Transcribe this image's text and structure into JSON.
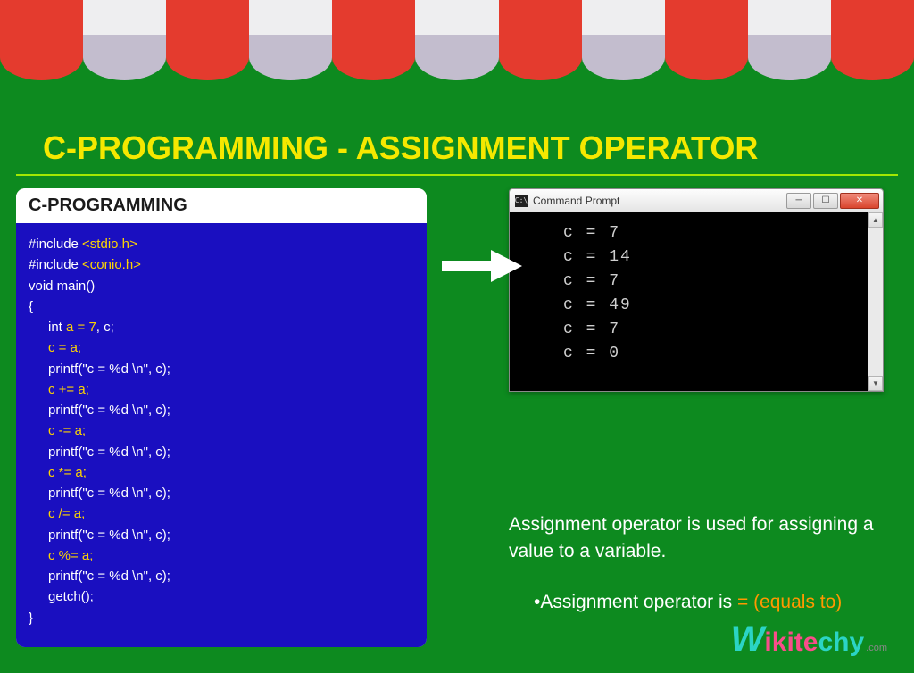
{
  "title": "C-PROGRAMMING - ASSIGNMENT OPERATOR",
  "code_header": "C-PROGRAMMING",
  "code": {
    "inc1a": "#include ",
    "inc1b": "<stdio.h>",
    "inc2a": "#include ",
    "inc2b": "<conio.h>",
    "main": "void main()",
    "ob": "{",
    "decl_a": "int ",
    "decl_b": "a = 7",
    "decl_c": ", c;",
    "s1": "c = a;",
    "p1": "printf(\"c = %d \\n\", c);",
    "s2": "c += a;",
    "p2": "printf(\"c = %d \\n\", c);",
    "s3": "c -= a;",
    "p3": "printf(\"c = %d \\n\", c);",
    "s4": "c *= a;",
    "p4": "printf(\"c = %d \\n\", c);",
    "s5": "c /= a;",
    "p5": "printf(\"c = %d \\n\", c);",
    "s6": "c %= a;",
    "p6": "printf(\"c = %d \\n\", c);",
    "getch": "getch();",
    "cb": "}"
  },
  "cmd": {
    "icon": "C:\\",
    "title": "Command Prompt",
    "output": "c = 7\nc = 14\nc = 7\nc = 49\nc = 7\nc = 0"
  },
  "desc": {
    "line1": "Assignment operator is used for assigning a value to a variable.",
    "bullet_a": "•Assignment operator is ",
    "bullet_b": "= (equals to)"
  },
  "logo": {
    "w": "W",
    "mid": "ikite",
    "end": "chy",
    "com": ".com"
  }
}
